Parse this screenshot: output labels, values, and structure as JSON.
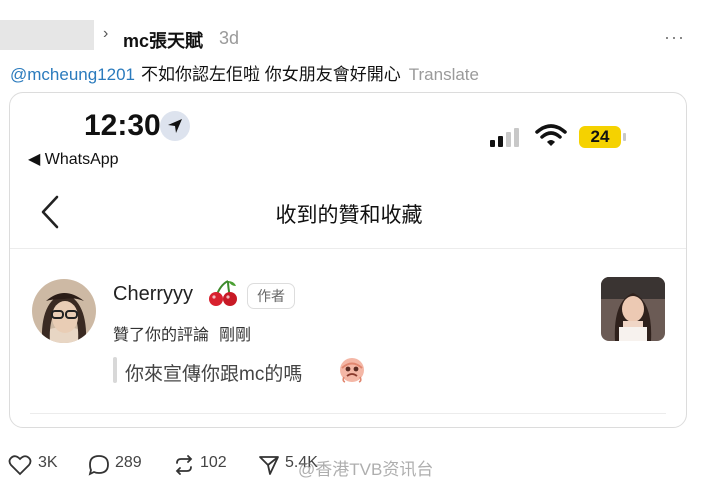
{
  "post": {
    "author": "mc張天賦",
    "time": "3d",
    "more_label": "···"
  },
  "reply": {
    "mention": "@mcheung1201",
    "text": "不如你認左佢啦 你女朋友會好開心",
    "translate": "Translate"
  },
  "phone": {
    "clock": "12:30",
    "back_app": "◀ WhatsApp",
    "battery": "24",
    "signal_bars": 2,
    "page_title": "收到的贊和收藏"
  },
  "notification": {
    "username": "Cherryyy",
    "role_tag": "作者",
    "action": "贊了你的評論",
    "when": "剛剛",
    "comment": "你來宣傳你跟mc的嗎"
  },
  "stats": {
    "likes": "3K",
    "comments": "289",
    "reposts": "102",
    "shares": "5.4K"
  },
  "watermark": "@香港TVB资讯台",
  "colors": {
    "mention": "#2b7bbd",
    "battery": "#f5d200",
    "muted": "#9a9a9a"
  },
  "icons": {
    "more": "more-dots-icon",
    "location": "location-arrow-icon",
    "signal": "cellular-signal-icon",
    "wifi": "wifi-icon",
    "back": "chevron-left-icon",
    "cherry": "cherry-emoji-icon",
    "emoji": "pleading-face-emoji-icon",
    "like": "heart-icon",
    "comment": "comment-bubble-icon",
    "repost": "repost-icon",
    "share": "send-icon"
  }
}
